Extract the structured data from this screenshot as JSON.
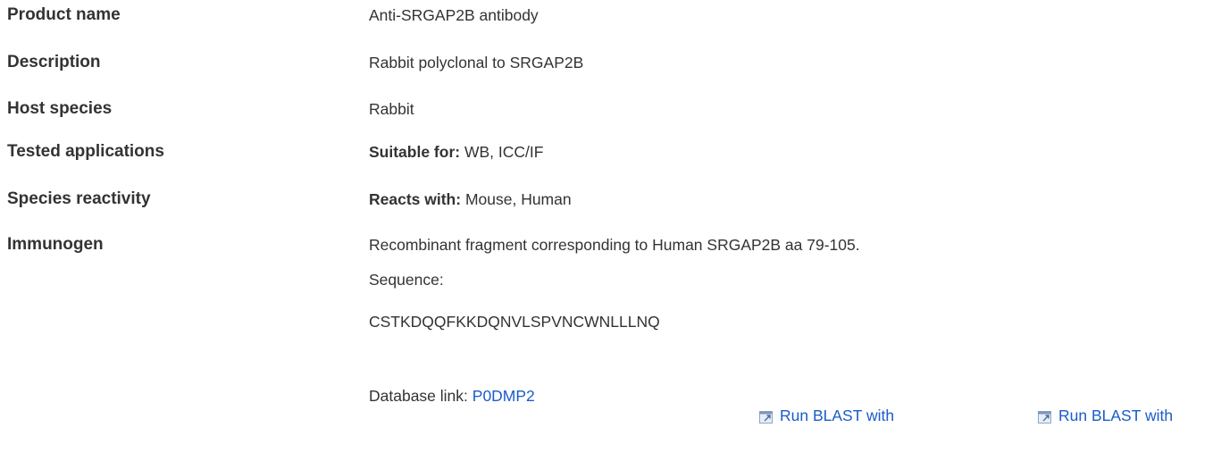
{
  "rows": [
    {
      "label": "Product name",
      "value": "Anti-SRGAP2B antibody"
    },
    {
      "label": "Description",
      "value": "Rabbit polyclonal to SRGAP2B"
    },
    {
      "label": "Host species",
      "value": "Rabbit"
    },
    {
      "label": "Tested applications",
      "value_bold": "Suitable for:",
      "value": " WB, ICC/IF"
    },
    {
      "label": "Species reactivity",
      "value_bold": "Reacts with:",
      "value": " Mouse, Human"
    },
    {
      "label": "Immunogen",
      "value": "Recombinant fragment corresponding to Human SRGAP2B aa 79-105."
    }
  ],
  "immunogen": {
    "sequence_label": "Sequence:",
    "sequence": "CSTKDQQFKKDQNVLSPVNCWNLLLNQ",
    "database_prefix": "Database link: ",
    "database_id": "P0DMP2"
  },
  "blast": [
    {
      "label": "Run BLAST with",
      "icon": "external-link-icon"
    },
    {
      "label": "Run BLAST with",
      "icon": "external-link-icon"
    }
  ],
  "colors": {
    "text": "#333333",
    "link": "#1a5cc8"
  }
}
